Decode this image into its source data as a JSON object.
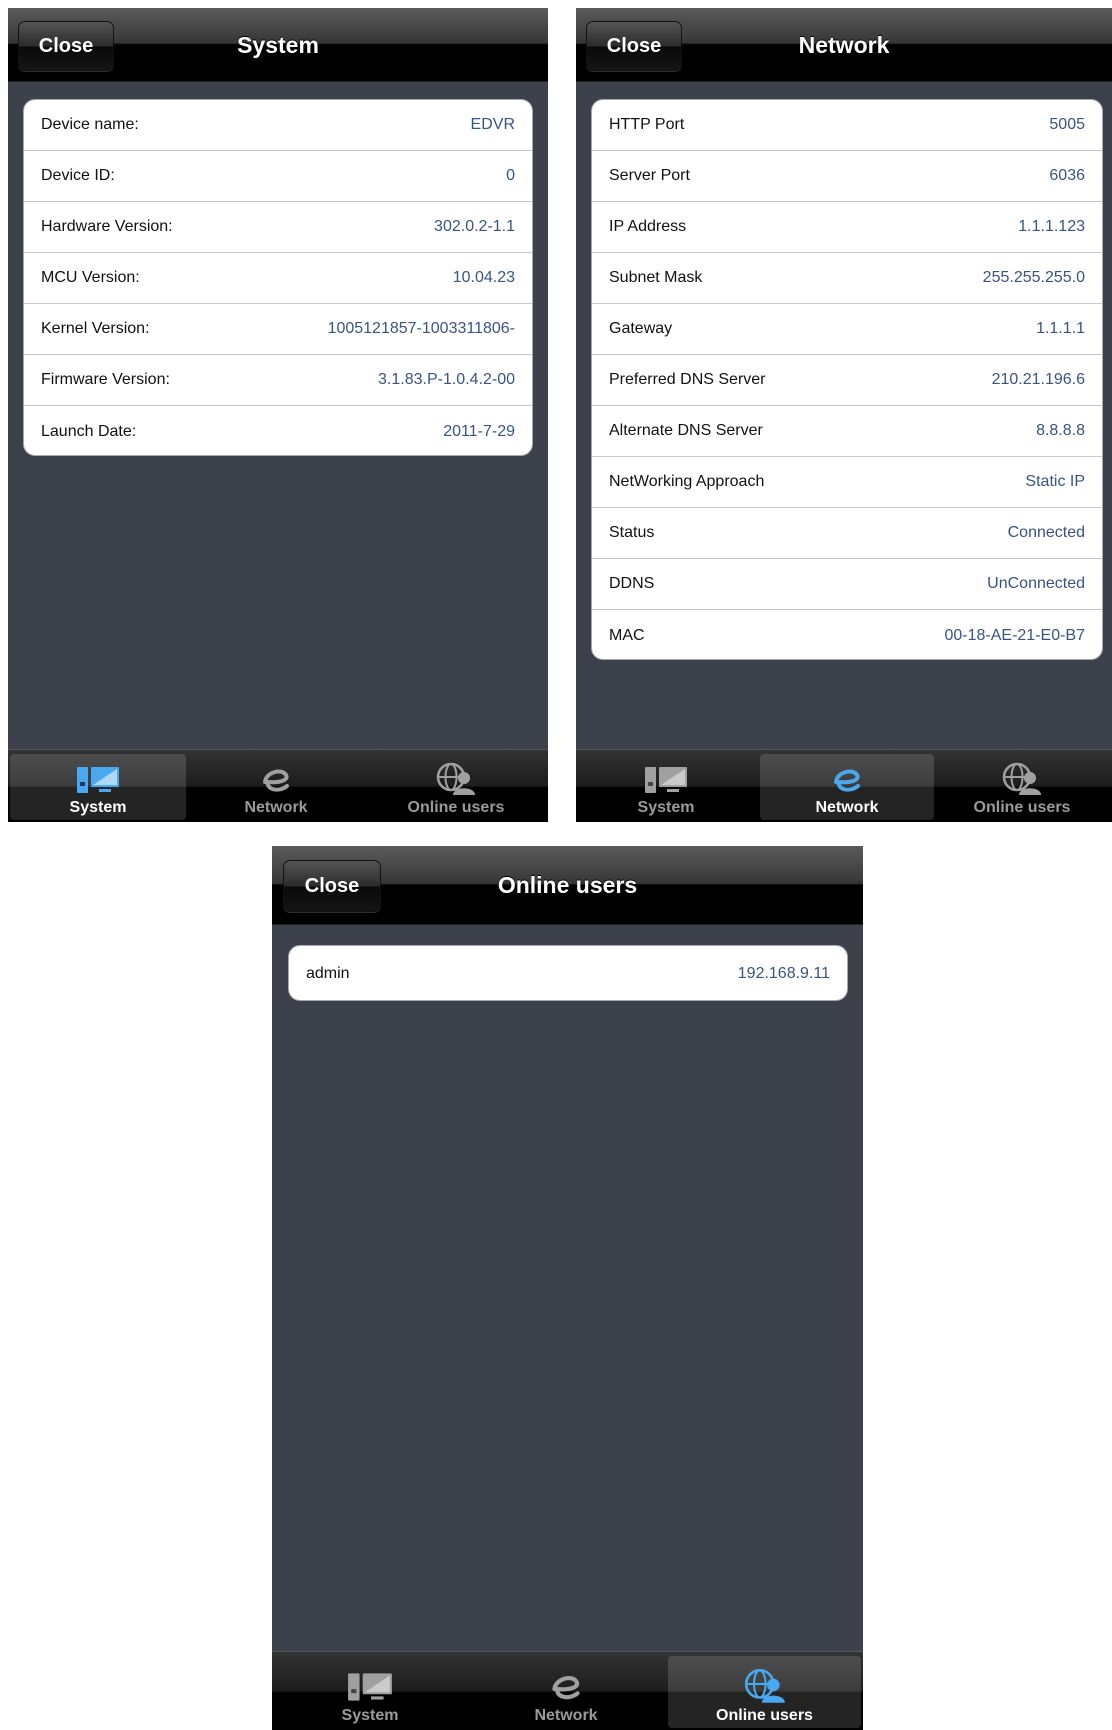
{
  "colors": {
    "screen_bg": "#3d414b",
    "value_text": "#385487",
    "tab_active_icon": "#4aa8f0",
    "tab_inactive_icon": "#a0a0a0"
  },
  "tabs": [
    {
      "label": "System",
      "icon": "system-icon"
    },
    {
      "label": "Network",
      "icon": "network-e-icon"
    },
    {
      "label": "Online users",
      "icon": "online-users-icon"
    }
  ],
  "screens": {
    "system": {
      "title": "System",
      "close_label": "Close",
      "active_tab": "System",
      "rows": [
        {
          "label": "Device name:",
          "value": "EDVR"
        },
        {
          "label": "Device ID:",
          "value": "0"
        },
        {
          "label": "Hardware Version:",
          "value": "302.0.2-1.1"
        },
        {
          "label": "MCU Version:",
          "value": "10.04.23"
        },
        {
          "label": "Kernel Version:",
          "value": "1005121857-1003311806-"
        },
        {
          "label": "Firmware Version:",
          "value": "3.1.83.P-1.0.4.2-00"
        },
        {
          "label": "Launch Date:",
          "value": "2011-7-29"
        }
      ]
    },
    "network": {
      "title": "Network",
      "close_label": "Close",
      "active_tab": "Network",
      "rows": [
        {
          "label": "HTTP Port",
          "value": "5005"
        },
        {
          "label": "Server Port",
          "value": "6036"
        },
        {
          "label": "IP Address",
          "value": "1.1.1.123"
        },
        {
          "label": "Subnet Mask",
          "value": "255.255.255.0"
        },
        {
          "label": "Gateway",
          "value": "1.1.1.1"
        },
        {
          "label": "Preferred DNS Server",
          "value": "210.21.196.6"
        },
        {
          "label": "Alternate DNS Server",
          "value": "8.8.8.8"
        },
        {
          "label": "NetWorking Approach",
          "value": "Static IP"
        },
        {
          "label": "Status",
          "value": "Connected"
        },
        {
          "label": "DDNS",
          "value": "UnConnected"
        },
        {
          "label": "MAC",
          "value": "00-18-AE-21-E0-B7"
        }
      ]
    },
    "online": {
      "title": "Online users",
      "close_label": "Close",
      "active_tab": "Online users",
      "rows": [
        {
          "label": "admin",
          "value": "192.168.9.11"
        }
      ]
    }
  }
}
